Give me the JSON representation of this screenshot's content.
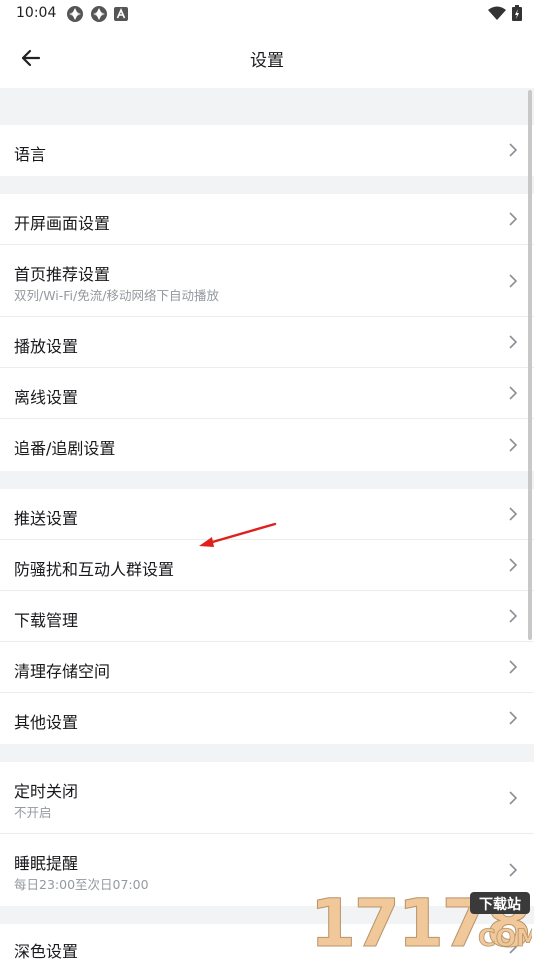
{
  "status_bar": {
    "time": "10:04"
  },
  "header": {
    "title": "设置"
  },
  "groups": [
    [
      {
        "title": "语言"
      }
    ],
    [
      {
        "title": "开屏画面设置"
      },
      {
        "title": "首页推荐设置",
        "subtitle": "双列/Wi-Fi/免流/移动网络下自动播放"
      },
      {
        "title": "播放设置"
      },
      {
        "title": "离线设置"
      },
      {
        "title": "追番/追剧设置"
      }
    ],
    [
      {
        "title": "推送设置"
      },
      {
        "title": "防骚扰和互动人群设置"
      },
      {
        "title": "下载管理"
      },
      {
        "title": "清理存储空间"
      },
      {
        "title": "其他设置"
      }
    ],
    [
      {
        "title": "定时关闭",
        "subtitle": "不开启"
      },
      {
        "title": "睡眠提醒",
        "subtitle": "每日23:00至次日07:00"
      }
    ],
    [
      {
        "title": "深色设置"
      }
    ]
  ],
  "watermark": {
    "digits": "17178",
    "badge": "下载站",
    "domain": "COM"
  },
  "colors": {
    "background": "#f2f3f5",
    "card": "#ffffff",
    "text_primary": "#18191c",
    "text_secondary": "#9499a0",
    "divider": "#ececec",
    "chevron": "#8c9096",
    "annotation_arrow": "#e0201b"
  }
}
